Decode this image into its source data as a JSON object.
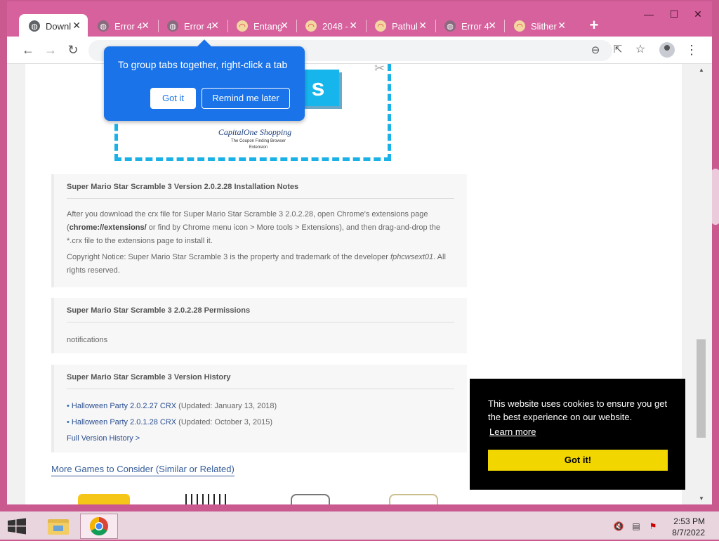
{
  "browser": {
    "tabs": [
      {
        "title": "Downl",
        "icon": "globe-icon",
        "active": true
      },
      {
        "title": "Error 4",
        "icon": "globe-icon"
      },
      {
        "title": "Error 4",
        "icon": "globe-icon"
      },
      {
        "title": "Entang",
        "icon": "rainbow-icon"
      },
      {
        "title": "2048 -",
        "icon": "rainbow-icon"
      },
      {
        "title": "Pathul",
        "icon": "rainbow-icon"
      },
      {
        "title": "Error 4",
        "icon": "globe-icon"
      },
      {
        "title": "Slither",
        "icon": "rainbow-icon"
      }
    ],
    "new_tab": "+",
    "window_controls": {
      "minimize": "—",
      "maximize": "☐",
      "close": "✕"
    },
    "nav": {
      "back": "←",
      "forward": "→",
      "reload": "↻"
    },
    "omnibox_icons": {
      "zoom": "⊖",
      "share": "⇱",
      "bookmark": "☆",
      "menu": "⋮"
    }
  },
  "tooltip": {
    "text": "To group tabs together, right-click a tab",
    "got_it": "Got it",
    "remind": "Remind me later"
  },
  "promo": {
    "blue_box": "s",
    "logo": "CapitalOne Shopping",
    "subtitle": "The Coupon Finding Browser Extension"
  },
  "install_notes": {
    "title": "Super Mario Star Scramble 3 Version 2.0.2.28 Installation Notes",
    "para1_a": "After you download the crx file for Super Mario Star Scramble 3 2.0.2.28, open Chrome's extensions page (",
    "para1_code": "chrome://extensions/",
    "para1_b": " or find by Chrome menu icon > More tools > Extensions), and then drag-and-drop the *.crx file to the extensions page to install it.",
    "para2_a": "Copyright Notice: Super Mario Star Scramble 3 is the property and trademark of the developer ",
    "para2_dev": "fphcwsext01",
    "para2_b": ". All rights reserved."
  },
  "permissions": {
    "title": "Super Mario Star Scramble 3 2.0.2.28 Permissions",
    "items": [
      "notifications"
    ]
  },
  "history": {
    "title": "Super Mario Star Scramble 3 Version History",
    "entries": [
      {
        "bullet": "•",
        "link": "Halloween Party 2.0.2.27 CRX",
        "updated": "(Updated: January 13, 2018)"
      },
      {
        "bullet": "•",
        "link": "Halloween Party 2.0.1.28 CRX",
        "updated": "(Updated: October 3, 2015)"
      }
    ],
    "full_link": "Full Version History >"
  },
  "more_games": "More Games to Consider (Similar or Related)",
  "cookie": {
    "message": "This website uses cookies to ensure you get the best experience on our website.",
    "learn_more": "Learn more",
    "button": "Got it!"
  },
  "taskbar": {
    "time": "2:53 PM",
    "date": "8/7/2022"
  }
}
